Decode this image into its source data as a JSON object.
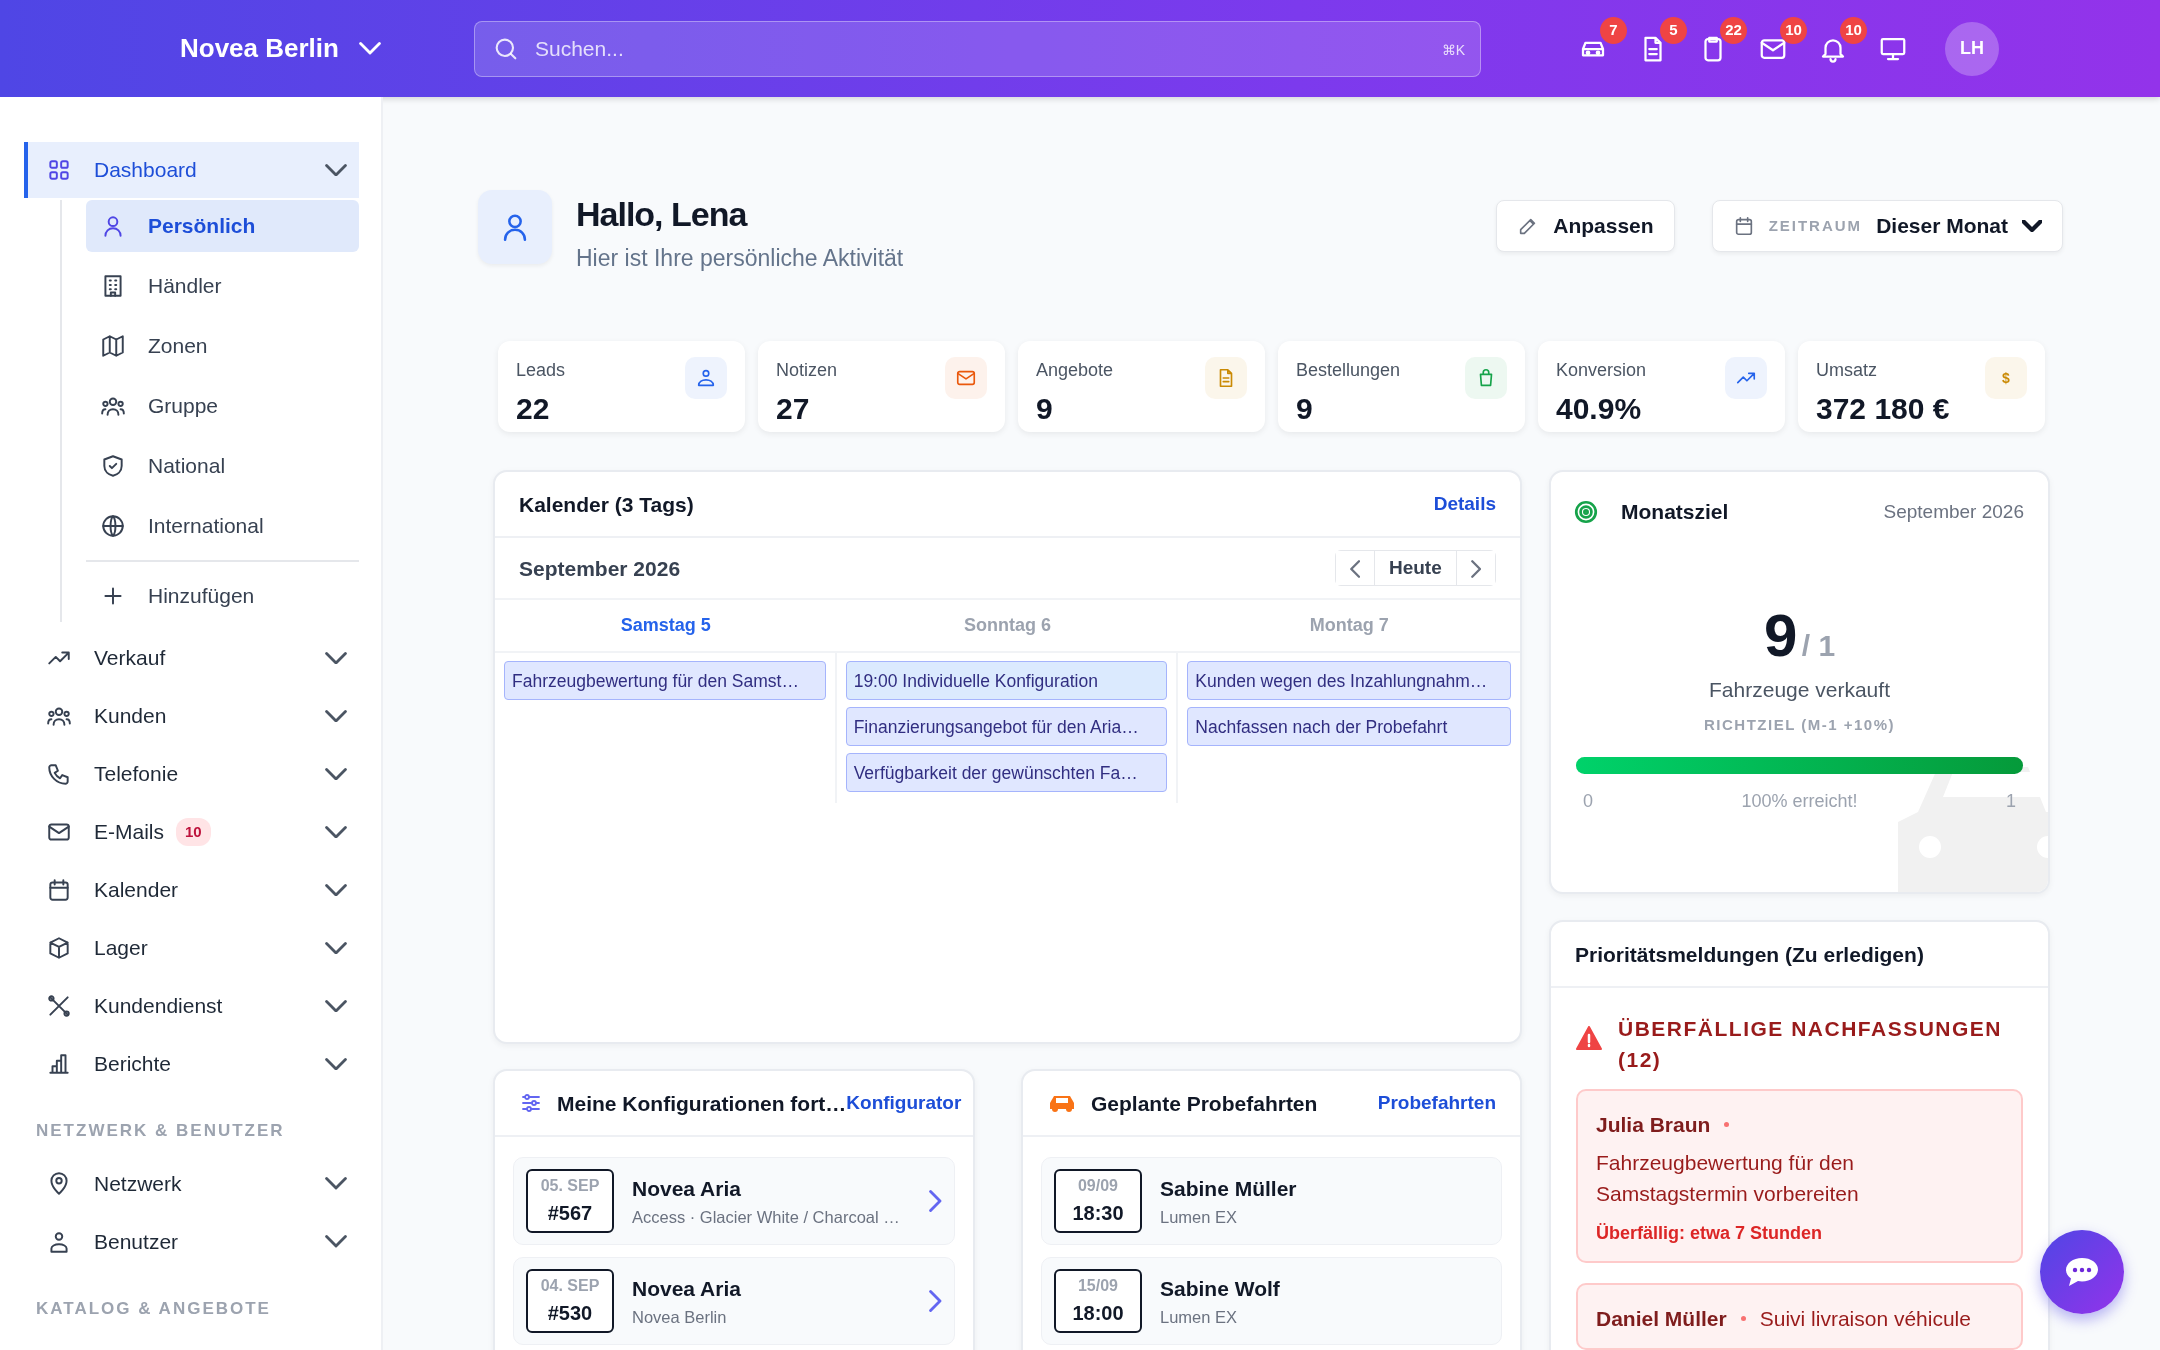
{
  "topbar": {
    "brand": "Novea Berlin",
    "search": {
      "placeholder": "Suchen...",
      "shortcut": "⌘K"
    },
    "icons": [
      {
        "kind": "car",
        "badge": "7"
      },
      {
        "kind": "document",
        "badge": "5"
      },
      {
        "kind": "clipboard",
        "badge": "22"
      },
      {
        "kind": "mail",
        "badge": "10"
      },
      {
        "kind": "bell",
        "badge": "10"
      },
      {
        "kind": "monitor"
      }
    ],
    "avatar": "LH"
  },
  "sidebar": {
    "groups": [
      {
        "items": [
          {
            "kind": "grid",
            "label": "Dashboard",
            "selected": true,
            "children": [
              {
                "kind": "user",
                "label": "Persönlich",
                "selected": true
              },
              {
                "kind": "building",
                "label": "Händler",
                "selected": false
              },
              {
                "kind": "map",
                "label": "Zonen",
                "selected": false
              },
              {
                "kind": "users",
                "label": "Gruppe",
                "selected": false
              },
              {
                "kind": "shield",
                "label": "National",
                "selected": false
              },
              {
                "kind": "globe",
                "label": "International",
                "selected": false
              },
              {
                "kind": "plus",
                "label": "Hinzufügen",
                "selected": false
              }
            ]
          },
          {
            "kind": "trend",
            "label": "Verkauf",
            "selected": false
          },
          {
            "kind": "users",
            "label": "Kunden",
            "selected": false
          },
          {
            "kind": "phone",
            "label": "Telefonie",
            "selected": false
          },
          {
            "kind": "mail",
            "label": "E-Mails",
            "badge": "10",
            "selected": false
          },
          {
            "kind": "calendar",
            "label": "Kalender",
            "selected": false
          },
          {
            "kind": "box",
            "label": "Lager",
            "selected": false
          },
          {
            "kind": "tools",
            "label": "Kundendienst",
            "selected": false
          },
          {
            "kind": "chart",
            "label": "Berichte",
            "selected": false
          }
        ]
      },
      {
        "heading": "NETZWERK & BENUTZER",
        "items": [
          {
            "kind": "pin",
            "label": "Netzwerk",
            "selected": false
          },
          {
            "kind": "usergroup",
            "label": "Benutzer",
            "selected": false
          }
        ]
      },
      {
        "heading": "KATALOG & ANGEBOTE"
      }
    ]
  },
  "header": {
    "title": "Hallo, Lena",
    "subtitle": "Hier ist Ihre persönliche Aktivität",
    "edit_button": "Anpassen",
    "period": {
      "label": "ZEITRAUM",
      "value": "Dieser Monat"
    }
  },
  "stats": [
    {
      "label": "Leads",
      "value": "22",
      "kind": "users2",
      "color": "#2563eb"
    },
    {
      "label": "Notizen",
      "value": "27",
      "kind": "mail",
      "color": "#ea580c"
    },
    {
      "label": "Angebote",
      "value": "9",
      "kind": "document",
      "color": "#ca8a04"
    },
    {
      "label": "Bestellungen",
      "value": "9",
      "kind": "bag",
      "color": "#16a34a"
    },
    {
      "label": "Konversion",
      "value": "40.9%",
      "kind": "trend",
      "color": "#2563eb"
    },
    {
      "label": "Umsatz",
      "value": "372 180 €",
      "kind": "currency",
      "symbol": "$",
      "color": "#ca8a04"
    }
  ],
  "calendar": {
    "title": "Kalender (3 Tags)",
    "link": "Details",
    "month": "September 2026",
    "today_button": "Heute",
    "days": [
      {
        "label": "Samstag 5",
        "selected": true,
        "events": [
          {
            "text": "Fahrzeugbewertung für den Samst…",
            "color": "#e0e7ff"
          }
        ]
      },
      {
        "label": "Sonntag 6",
        "selected": false,
        "events": [
          {
            "text": "19:00 Individuelle Konfiguration",
            "color": "#dbeafe"
          },
          {
            "text": "Finanzierungsangebot für den Aria…",
            "color": "#e0e7ff"
          },
          {
            "text": "Verfügbarkeit der gewünschten Fa…",
            "color": "#e0e7ff"
          }
        ]
      },
      {
        "label": "Montag 7",
        "selected": false,
        "events": [
          {
            "text": "Kunden wegen des Inzahlungnahm…",
            "color": "#e0e7ff"
          },
          {
            "text": "Nachfassen nach der Probefahrt",
            "color": "#e0e7ff"
          }
        ]
      }
    ]
  },
  "goal": {
    "title": "Monatsziel",
    "period": "September 2026",
    "value": "9",
    "target": "/ 1",
    "label": "Fahrzeuge verkauft",
    "sublabel": "RICHTZIEL (M-1 +10%)",
    "level": 1,
    "scale_min": "0",
    "reading": "100% erreicht!",
    "scale_max": "1"
  },
  "priority": {
    "title": "Prioritätsmeldungen (Zu erledigen)",
    "heading": "ÜBERFÄLLIGE NACHFASSUNGEN (12)",
    "items": [
      {
        "name": "Julia Braun",
        "text": "Fahrzeugbewertung für den Samstagstermin vorbereiten",
        "due": "Überfällig: etwa 7 Stunden"
      },
      {
        "name": "Daniel Müller",
        "text": "Suivi livraison véhicule"
      }
    ]
  },
  "configurations": {
    "title": "Meine Konfigurationen fort…",
    "link": "Konfigurator",
    "items": [
      {
        "date": "05. SEP",
        "number": "#567",
        "title": "Novea Aria",
        "subtitle": "Access · Glacier White / Charcoal …"
      },
      {
        "date": "04. SEP",
        "number": "#530",
        "title": "Novea Aria",
        "subtitle": "Novea Berlin"
      }
    ]
  },
  "test_drives": {
    "title": "Geplante Probefahrten",
    "link": "Probefahrten",
    "items": [
      {
        "date": "09/09",
        "time": "18:30",
        "name": "Sabine Müller",
        "model": "Lumen EX"
      },
      {
        "date": "15/09",
        "time": "18:00",
        "name": "Sabine Wolf",
        "model": "Lumen EX"
      }
    ]
  }
}
